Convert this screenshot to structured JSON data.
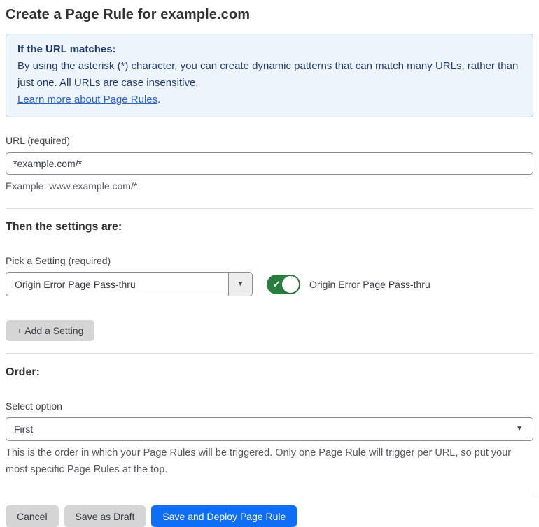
{
  "page_title": "Create a Page Rule for example.com",
  "info_box": {
    "heading": "If the URL matches:",
    "body": "By using the asterisk (*) character, you can create dynamic patterns that can match many URLs, rather than just one. All URLs are case insensitive.",
    "link_label": "Learn more about Page Rules",
    "link_suffix": "."
  },
  "url_field": {
    "label": "URL (required)",
    "value": "*example.com/*",
    "helper": "Example: www.example.com/*"
  },
  "settings_section": {
    "heading": "Then the settings are:",
    "picker_label": "Pick a Setting (required)",
    "picker_value": "Origin Error Page Pass-thru",
    "toggle_state": "on",
    "toggle_label": "Origin Error Page Pass-thru",
    "add_setting_label": "+ Add a Setting"
  },
  "order_section": {
    "heading": "Order:",
    "select_label": "Select option",
    "select_value": "First",
    "helper": "This is the order in which your Page Rules will be triggered. Only one Page Rule will trigger per URL, so put your most specific Page Rules at the top."
  },
  "footer": {
    "cancel_label": "Cancel",
    "save_draft_label": "Save as Draft",
    "save_deploy_label": "Save and Deploy Page Rule"
  },
  "icons": {
    "toggle_check": "✓",
    "dropdown_arrow": "▼"
  },
  "colors": {
    "info_box_bg": "#edf4fc",
    "info_box_border": "#a9c9ef",
    "info_text": "#1f3a71",
    "link_blue": "#2c62c9",
    "toggle_on_green": "#287d3f",
    "primary_button_blue": "#0e6ef5",
    "secondary_button_gray": "#d5d5d5"
  }
}
